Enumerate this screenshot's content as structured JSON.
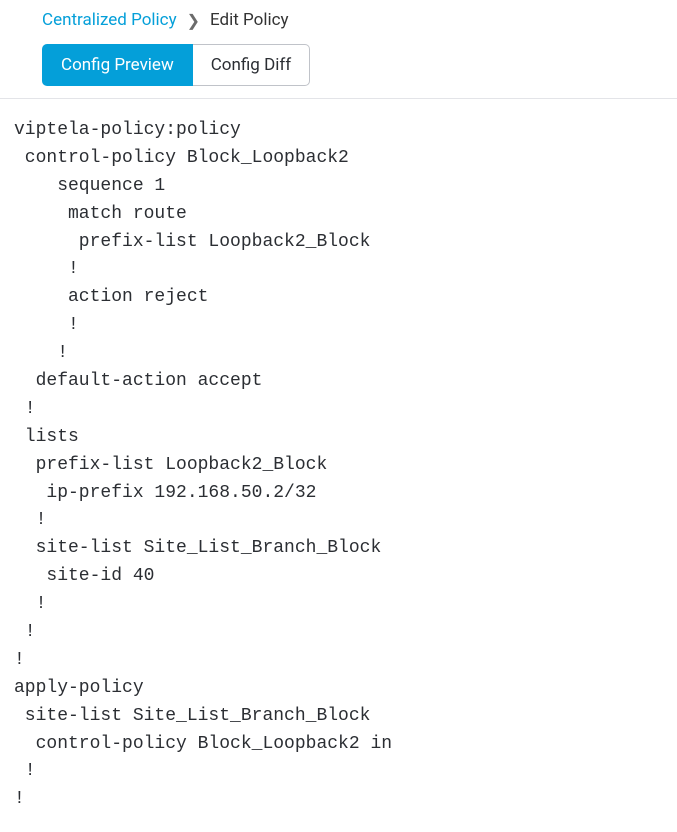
{
  "breadcrumb": {
    "parent": "Centralized Policy",
    "current": "Edit Policy"
  },
  "tabs": {
    "preview": "Config Preview",
    "diff": "Config Diff"
  },
  "config_text": "viptela-policy:policy\n control-policy Block_Loopback2\n    sequence 1\n     match route\n      prefix-list Loopback2_Block\n     !\n     action reject\n     !\n    !\n  default-action accept\n !\n lists\n  prefix-list Loopback2_Block\n   ip-prefix 192.168.50.2/32\n  !\n  site-list Site_List_Branch_Block\n   site-id 40\n  !\n !\n!\napply-policy\n site-list Site_List_Branch_Block\n  control-policy Block_Loopback2 in\n !\n!"
}
